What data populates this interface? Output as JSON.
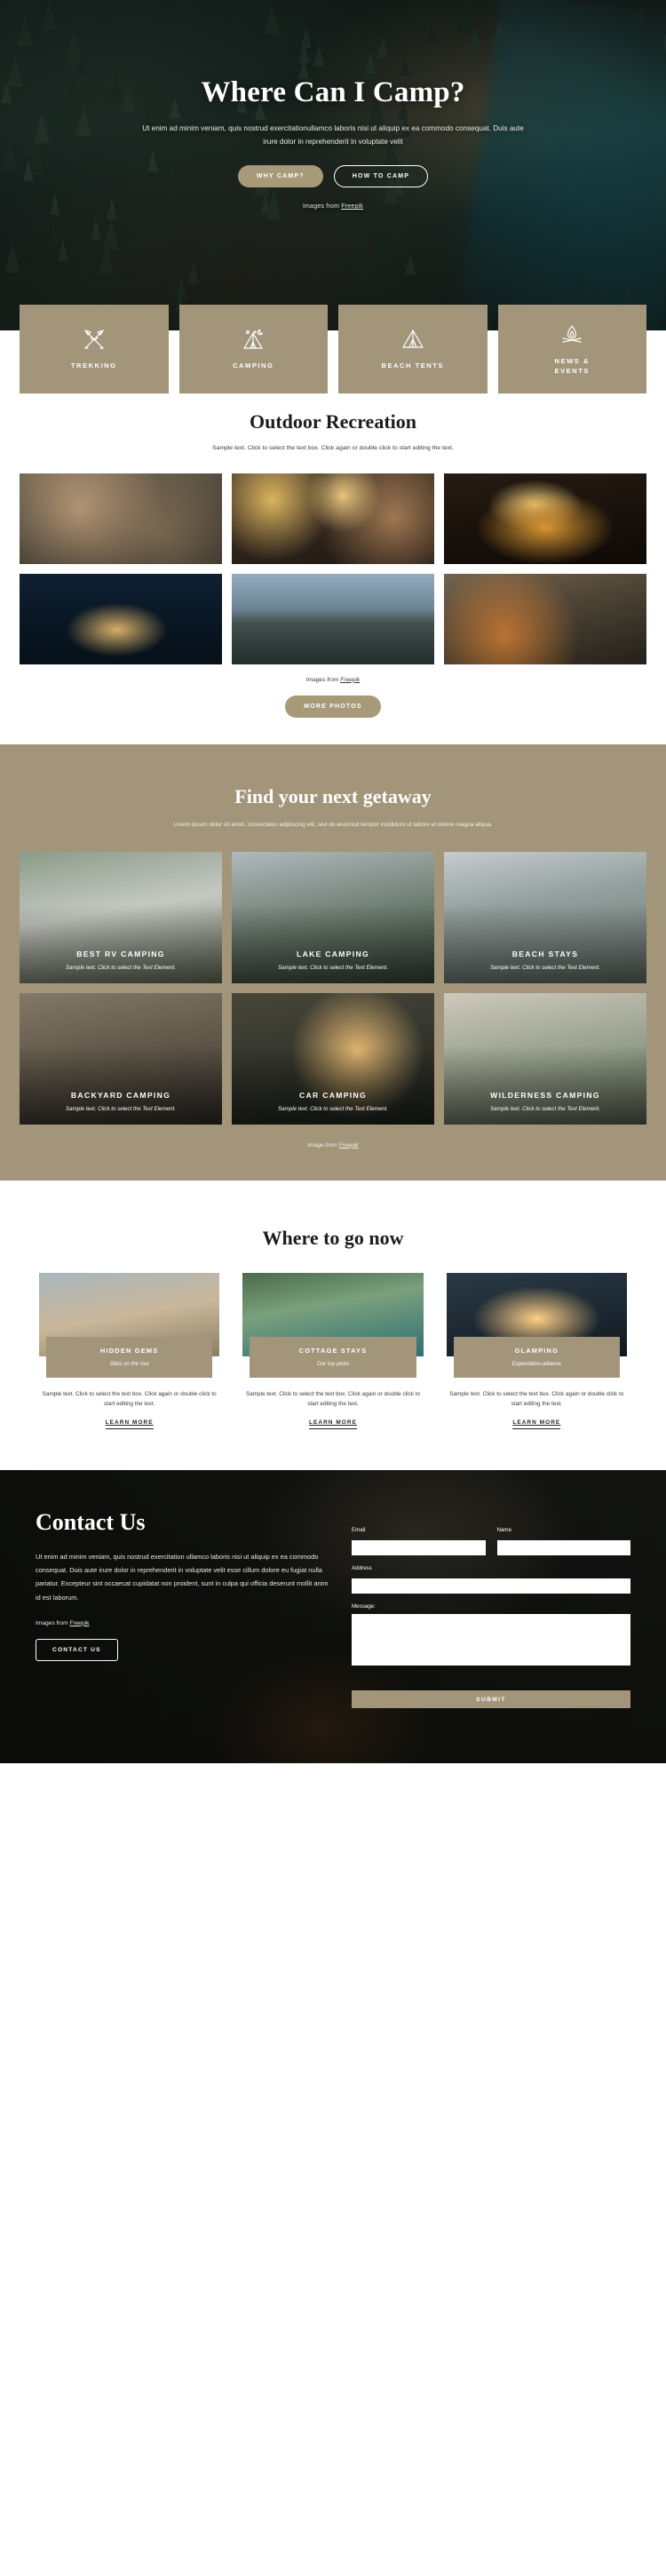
{
  "hero": {
    "title": "Where Can I Camp?",
    "subtitle": "Ut enim ad minim veniam, quis nostrud exercitationullamco laboris nisi ut aliquip ex ea commodo consequat. Duis aute irure dolor in reprehenderit in voluptate velit",
    "primary_button": "WHY CAMP?",
    "secondary_button": "HOW TO CAMP",
    "credit_prefix": "Images from ",
    "credit_link": "Freepik"
  },
  "categories": [
    {
      "label": "TREKKING",
      "icon": "crossed-arrows-icon"
    },
    {
      "label": "CAMPING",
      "icon": "tipi-tent-night-icon"
    },
    {
      "label": "BEACH TENTS",
      "icon": "tent-icon"
    },
    {
      "label": "NEWS &\nEVENTS",
      "icon": "campfire-icon"
    }
  ],
  "recreation": {
    "title": "Outdoor Recreation",
    "subtitle": "Sample text. Click to select the text box. Click again or double click to start editing the text.",
    "photos": [
      "friends-cooking-at-camp",
      "friends-with-string-lights",
      "bonfire-logs",
      "lit-tent-at-night-lake",
      "mountain-lake-panorama",
      "couple-by-campfire"
    ],
    "credit_prefix": "Images from ",
    "credit_link": "Freepik",
    "more_button": "MORE PHOTOS"
  },
  "getaway": {
    "title": "Find your next getaway",
    "subtitle": "Lorem ipsum dolor sit amet, consectetur adipiscing elit, sed do eiusmod tempor incididunt ut labore et dolore magna aliqua.",
    "cards": [
      {
        "title": "BEST RV CAMPING",
        "desc": "Sample text. Click to select the Text Element."
      },
      {
        "title": "LAKE CAMPING",
        "desc": "Sample text. Click to select the Text Element."
      },
      {
        "title": "BEACH STAYS",
        "desc": "Sample text. Click to select the Text Element."
      },
      {
        "title": "BACKYARD CAMPING",
        "desc": "Sample text. Click to select the Text Element."
      },
      {
        "title": "CAR CAMPING",
        "desc": "Sample text. Click to select the Text Element."
      },
      {
        "title": "WILDERNESS CAMPING",
        "desc": "Sample text. Click to select the Text Element."
      }
    ],
    "credit_prefix": "Image from ",
    "credit_link": "Freepik"
  },
  "where_to_go": {
    "title": "Where to go now",
    "cards": [
      {
        "title": "HIDDEN GEMS",
        "subtitle": "Sites on the rise",
        "body": "Sample text. Click to select the text box. Click again or double click to start editing the text.",
        "link": "LEARN MORE"
      },
      {
        "title": "COTTAGE STAYS",
        "subtitle": "Our top picks",
        "body": "Sample text. Click to select the text box. Click again or double click to start editing the text.",
        "link": "LEARN MORE"
      },
      {
        "title": "GLAMPING",
        "subtitle": "Expectation-alliance",
        "body": "Sample text. Click to select the text box. Click again or double click to start editing the text.",
        "link": "LEARN MORE"
      }
    ]
  },
  "contact": {
    "title": "Contact Us",
    "body": "Ut enim ad minim veniam, quis nostrud exercitation ullamco laboris nisi ut aliquip ex ea commodo consequat. Duis aute irure dolor in reprehenderit in voluptate velit esse cillum dolore eu fugiat nulla pariatur. Excepteur sint occaecat cupidatat non proident, sunt in culpa qui officia deserunt mollit anim id est laborum.",
    "credit_prefix": "Images from ",
    "credit_link": "Freepik",
    "button": "CONTACT US",
    "form": {
      "email_label": "Email",
      "email_value": "",
      "name_label": "Name",
      "name_value": "",
      "address_label": "Address",
      "address_value": "",
      "message_label": "Message:",
      "message_value": "",
      "submit_label": "SUBMIT"
    }
  },
  "colors": {
    "accent": "#a2957a",
    "hero_dark": "#16211d",
    "contact_dark": "#1a1b17"
  }
}
